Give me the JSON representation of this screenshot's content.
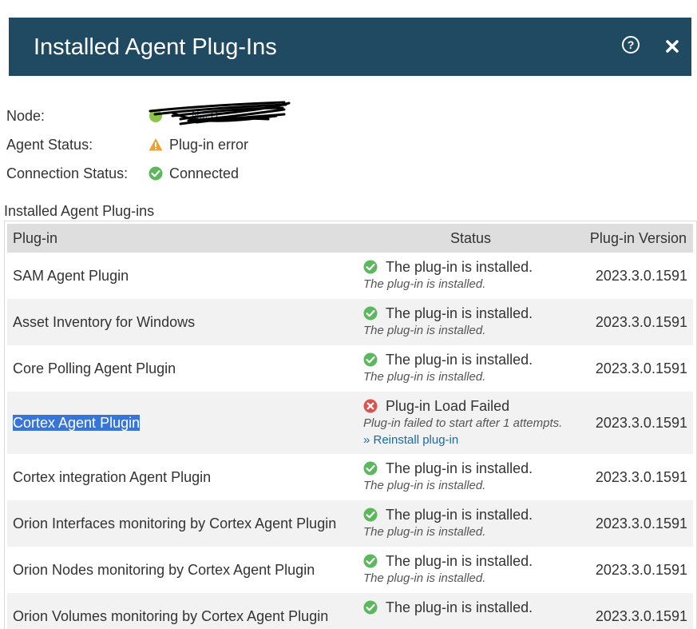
{
  "dialog": {
    "title": "Installed Agent Plug-Ins",
    "help_icon": "question-circle-icon",
    "close_icon": "close-x-icon"
  },
  "info": {
    "node_label": "Node:",
    "node_value": "N... D",
    "agent_status_label": "Agent Status:",
    "agent_status_value": "Plug-in error",
    "connection_status_label": "Connection Status:",
    "connection_status_value": "Connected"
  },
  "section_title": "Installed Agent Plug-ins",
  "grid": {
    "headers": {
      "plugin": "Plug-in",
      "status": "Status",
      "version": "Plug-in Version"
    },
    "rows": [
      {
        "name": "SAM Agent Plugin",
        "status": "The plug-in is installed.",
        "detail": "The plug-in is installed.",
        "version": "2023.3.0.1591"
      },
      {
        "name": "Asset Inventory for Windows",
        "status": "The plug-in is installed.",
        "detail": "The plug-in is installed.",
        "version": "2023.3.0.1591"
      },
      {
        "name": "Core Polling Agent Plugin",
        "status": "The plug-in is installed.",
        "detail": "The plug-in is installed.",
        "version": "2023.3.0.1591"
      },
      {
        "name": "Cortex Agent Plugin",
        "status": "Plug-in Load Failed",
        "detail": "Plug-in failed to start after 1 attempts.",
        "action": "» Reinstall plug-in",
        "version": "2023.3.0.1591"
      },
      {
        "name": "Cortex integration Agent Plugin",
        "status": "The plug-in is installed.",
        "detail": "The plug-in is installed.",
        "version": "2023.3.0.1591"
      },
      {
        "name": "Orion Interfaces monitoring by Cortex Agent Plugin",
        "status": "The plug-in is installed.",
        "detail": "The plug-in is installed.",
        "version": "2023.3.0.1591"
      },
      {
        "name": "Orion Nodes monitoring by Cortex Agent Plugin",
        "status": "The plug-in is installed.",
        "detail": "The plug-in is installed.",
        "version": "2023.3.0.1591"
      },
      {
        "name": "Orion Volumes monitoring by Cortex Agent Plugin",
        "status": "The plug-in is installed.",
        "detail": "",
        "version": "2023.3.0.1591"
      }
    ]
  },
  "colors": {
    "titlebar": "#204a62",
    "ok_green": "#5cb85c",
    "warning_orange": "#f0a030",
    "error_red": "#d9534f",
    "link_blue": "#1a6aa6"
  }
}
